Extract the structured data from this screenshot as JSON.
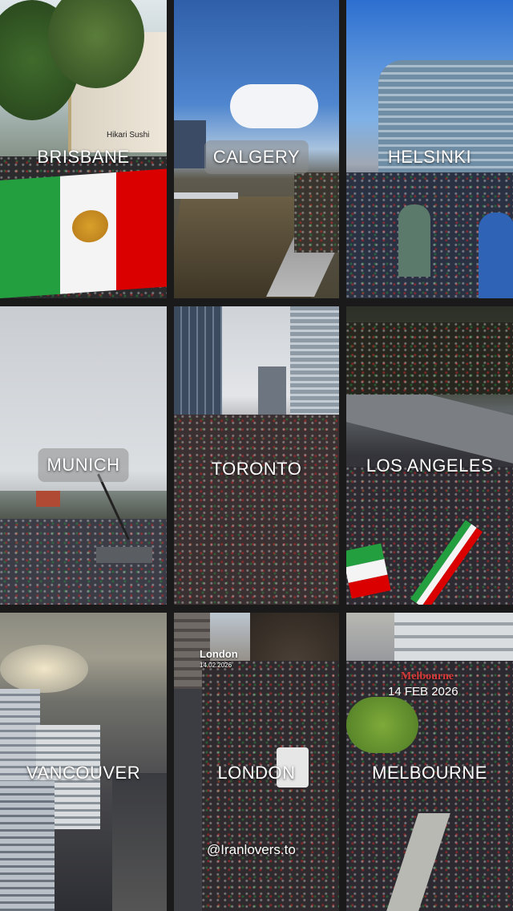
{
  "tiles": [
    {
      "city": "BRISBANE"
    },
    {
      "city": "CALGERY"
    },
    {
      "city": "HELSINKI"
    },
    {
      "city": "MUNICH"
    },
    {
      "city": "TORONTO"
    },
    {
      "city": "LOS ANGELES"
    },
    {
      "city": "VANCOUVER"
    },
    {
      "city": "LONDON"
    },
    {
      "city": "MELBOURNE"
    }
  ],
  "brisbane_sign": "Hikari Sushi",
  "london_overlay": {
    "title": "London",
    "date": "14.02.2026"
  },
  "melbourne_overlay": {
    "title": "Melbourne",
    "date": "14 FEB 2026"
  },
  "watermark": "@Iranlovers.to",
  "colors": {
    "flag_green": "#239f40",
    "flag_white": "#ffffff",
    "flag_red": "#da0000",
    "label_text": "#ffffff",
    "gap": "#1a1a1a"
  }
}
